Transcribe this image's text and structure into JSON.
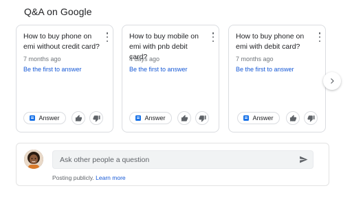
{
  "section": {
    "title": "Q&A on Google"
  },
  "questions": [
    {
      "text": "How to buy phone on emi without credit card?",
      "age": "7 months ago",
      "first_answer_link": "Be the first to answer",
      "answer_label": "Answer"
    },
    {
      "text": "How to buy mobile on emi with pnb debit card?",
      "age": "4 days ago",
      "first_answer_link": "Be the first to answer",
      "answer_label": "Answer"
    },
    {
      "text": "How to buy phone on emi with debit card?",
      "age": "7 months ago",
      "first_answer_link": "Be the first to answer",
      "answer_label": "Answer"
    }
  ],
  "ask": {
    "placeholder": "Ask other people a question",
    "posting_note": "Posting publicly.",
    "learn_more": "Learn more"
  },
  "icons": {
    "more": "more-vert-icon",
    "answer": "answer-icon",
    "thumb_up": "thumb-up-icon",
    "thumb_down": "thumb-down-icon",
    "next": "chevron-right-icon",
    "send": "send-icon"
  },
  "colors": {
    "link": "#1558d6",
    "accent": "#1a73e8",
    "border": "#dadce0",
    "muted_text": "#70757a"
  }
}
